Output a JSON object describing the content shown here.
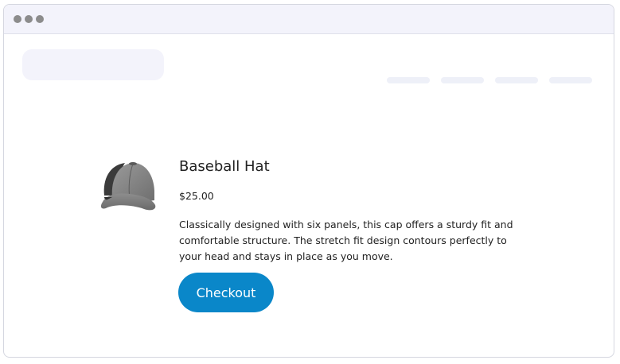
{
  "product": {
    "name": "Baseball Hat",
    "price": "$25.00",
    "description": "Classically designed with six panels, this cap offers a sturdy fit and comfortable structure. The stretch fit design contours perfectly to your head and stays in place as you move.",
    "image_icon": "baseball-cap-icon"
  },
  "actions": {
    "checkout_label": "Checkout"
  },
  "colors": {
    "accent": "#0a87c9",
    "placeholder": "#f3f3fb",
    "window_dots": "#8c8c8c"
  }
}
